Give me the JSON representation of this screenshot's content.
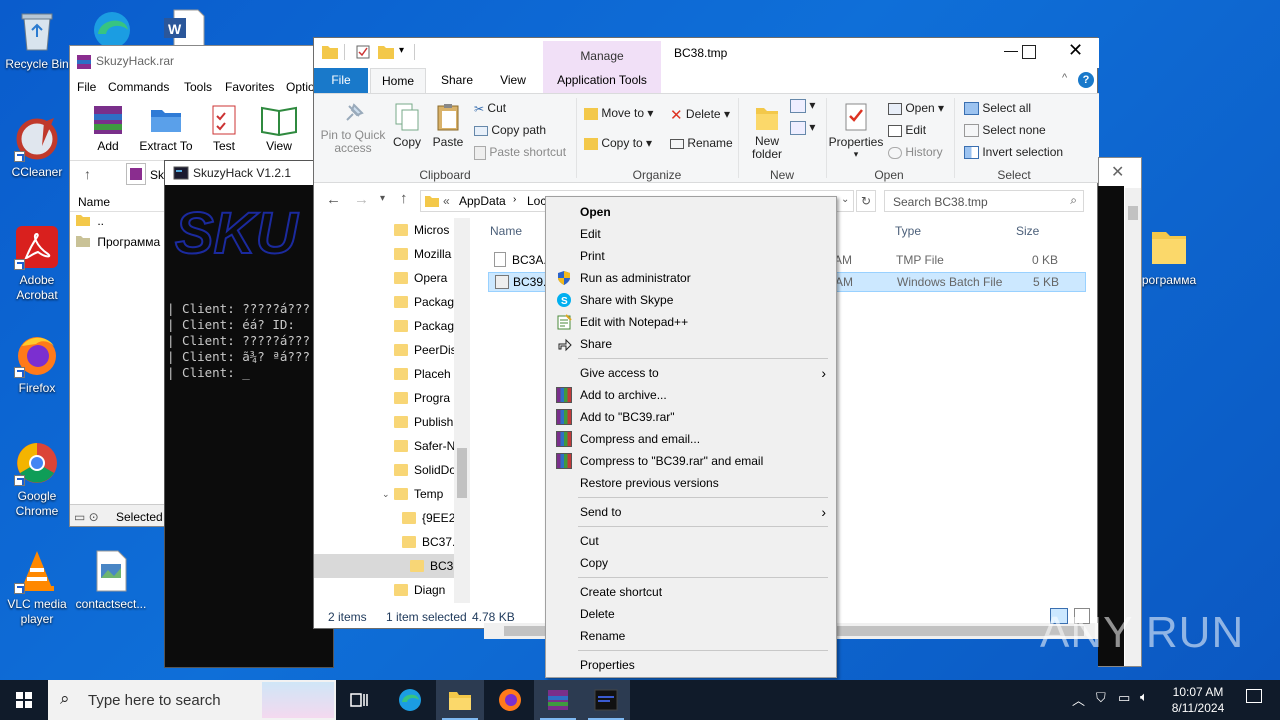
{
  "desktop": {
    "icons": [
      {
        "label": "Recycle Bin"
      },
      {
        "label": "CCleaner"
      },
      {
        "label": "Adobe Acrobat"
      },
      {
        "label": "Firefox"
      },
      {
        "label": "Google Chrome"
      },
      {
        "label": "VLC media player"
      },
      {
        "label": "contactsect..."
      },
      {
        "label": "рограмма"
      }
    ]
  },
  "winrar": {
    "title": "SkuzyHack.rar",
    "menu": [
      "File",
      "Commands",
      "Tools",
      "Favorites",
      "Optio"
    ],
    "toolbar": [
      "Add",
      "Extract To",
      "Test",
      "View"
    ],
    "path_fragment": "Sk",
    "column_name": "Name",
    "rows": [
      "..",
      "Программа"
    ],
    "status": "Selected"
  },
  "console": {
    "title": "SkuzyHack V1.2.1",
    "lines": [
      "| Client: ?????á???",
      "| Client: éá? ID:",
      "| Client: ?????á???",
      "| Client: ã¾? ªá???",
      "| Client: _"
    ]
  },
  "explorer": {
    "title": "BC38.tmp",
    "context_tab": "Manage",
    "tabs": [
      "File",
      "Home",
      "Share",
      "View",
      "Application Tools"
    ],
    "clipboard": {
      "pin": "Pin to Quick access",
      "copy": "Copy",
      "paste": "Paste",
      "cut": "Cut",
      "copy_path": "Copy path",
      "paste_shortcut": "Paste shortcut",
      "label": "Clipboard"
    },
    "organize": {
      "move_to": "Move to",
      "copy_to": "Copy to",
      "delete": "Delete",
      "rename": "Rename",
      "label": "Organize"
    },
    "new": {
      "new_folder": "New folder",
      "label": "New"
    },
    "open": {
      "properties": "Properties",
      "open": "Open",
      "edit": "Edit",
      "history": "History",
      "label": "Open"
    },
    "select": {
      "all": "Select all",
      "none": "Select none",
      "invert": "Invert selection",
      "label": "Select"
    },
    "address": {
      "seg1": "«",
      "seg2": "AppData",
      "seg3": "Loc"
    },
    "search_placeholder": "Search BC38.tmp",
    "nav": [
      "Micros",
      "Mozilla",
      "Opera",
      "Packag",
      "Packag",
      "PeerDis",
      "Placeh",
      "Progra",
      "Publish",
      "Safer-N",
      "SolidDo",
      "Temp",
      "{9EE2",
      "BC37.",
      "BC3",
      "Diagn"
    ],
    "columns": {
      "name": "Name",
      "type": "Type",
      "size": "Size"
    },
    "files": [
      {
        "name": "BC3A.t",
        "time": "AM",
        "type": "TMP File",
        "size": "0 KB"
      },
      {
        "name": "BC39.b",
        "time": "AM",
        "type": "Windows Batch File",
        "size": "5 KB"
      }
    ],
    "status": {
      "items": "2 items",
      "selected": "1 item selected",
      "size": "4.78 KB"
    }
  },
  "context_menu": {
    "items": [
      "Open",
      "Edit",
      "Print",
      "Run as administrator",
      "Share with Skype",
      "Edit with Notepad++",
      "Share",
      "Give access to",
      "Add to archive...",
      "Add to \"BC39.rar\"",
      "Compress and email...",
      "Compress to \"BC39.rar\" and email",
      "Restore previous versions",
      "Send to",
      "Cut",
      "Copy",
      "Create shortcut",
      "Delete",
      "Rename",
      "Properties"
    ]
  },
  "taskbar": {
    "search_placeholder": "Type here to search",
    "time": "10:07 AM",
    "date": "8/11/2024"
  },
  "watermark": "ANY RUN"
}
